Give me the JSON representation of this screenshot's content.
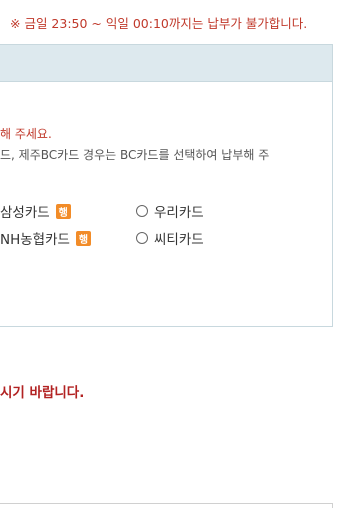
{
  "notice": "※ 금일 23:50 ~ 익일 00:10까지는 납부가 불가합니다.",
  "guide": {
    "line1": "해 주세요.",
    "line2": "드, 제주BC카드 경우는 BC카드를 선택하여 납부해 주"
  },
  "cards": [
    {
      "label": "삼성카드",
      "badge": "행"
    },
    {
      "label": "우리카드",
      "badge": ""
    },
    {
      "label": "NH농협카드",
      "badge": "행"
    },
    {
      "label": "씨티카드",
      "badge": ""
    }
  ],
  "warning": "시기 바랍니다.",
  "colors": {
    "accent_red": "#c0392b",
    "header_bg": "#dde9ee",
    "badge_orange": "#f28c28"
  }
}
